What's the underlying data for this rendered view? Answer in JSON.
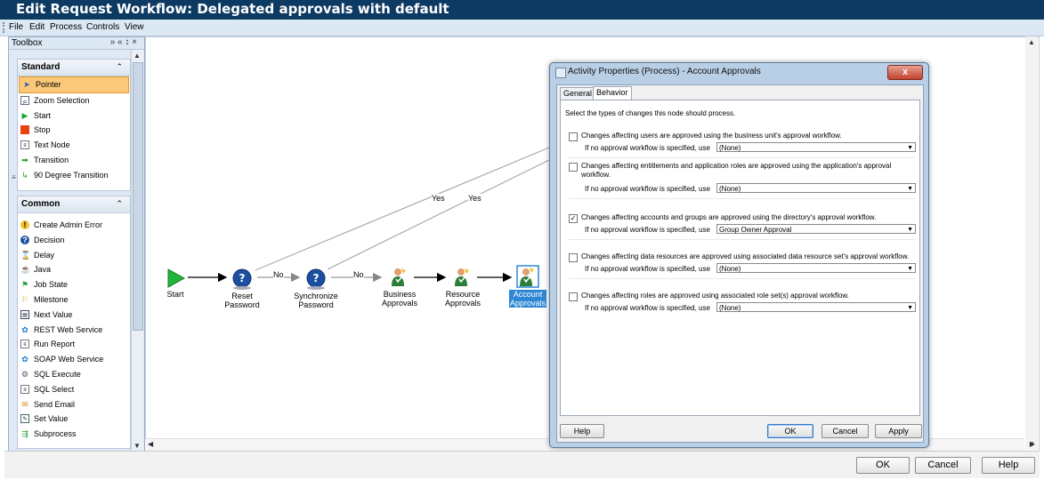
{
  "window": {
    "title": "Edit Request Workflow: Delegated approvals with default"
  },
  "menu": [
    "File",
    "Edit",
    "Process",
    "Controls",
    "View"
  ],
  "toolbox": {
    "title": "Toolbox",
    "header_controls": "» « ↕ ×",
    "sections": [
      {
        "title": "Standard",
        "items": [
          {
            "label": "Pointer",
            "icon": "pointer-icon",
            "selected": true
          },
          {
            "label": "Zoom Selection",
            "icon": "zoom-selection-icon"
          },
          {
            "label": "Start",
            "icon": "start-icon"
          },
          {
            "label": "Stop",
            "icon": "stop-icon"
          },
          {
            "label": "Text Node",
            "icon": "text-node-icon"
          },
          {
            "label": "Transition",
            "icon": "transition-icon"
          },
          {
            "label": "90 Degree Transition",
            "icon": "degree-transition-icon"
          }
        ]
      },
      {
        "title": "Common",
        "items": [
          {
            "label": "Create Admin Error",
            "icon": "admin-error-icon"
          },
          {
            "label": "Decision",
            "icon": "decision-icon"
          },
          {
            "label": "Delay",
            "icon": "delay-icon"
          },
          {
            "label": "Java",
            "icon": "java-icon"
          },
          {
            "label": "Job State",
            "icon": "job-state-icon"
          },
          {
            "label": "Milestone",
            "icon": "milestone-icon"
          },
          {
            "label": "Next Value",
            "icon": "next-value-icon"
          },
          {
            "label": "REST Web Service",
            "icon": "rest-service-icon"
          },
          {
            "label": "Run Report",
            "icon": "run-report-icon"
          },
          {
            "label": "SOAP Web Service",
            "icon": "soap-service-icon"
          },
          {
            "label": "SQL Execute",
            "icon": "sql-execute-icon"
          },
          {
            "label": "SQL Select",
            "icon": "sql-select-icon"
          },
          {
            "label": "Send Email",
            "icon": "send-email-icon"
          },
          {
            "label": "Set Value",
            "icon": "set-value-icon"
          },
          {
            "label": "Subprocess",
            "icon": "subprocess-icon"
          }
        ]
      }
    ]
  },
  "workflow": {
    "nodes": {
      "start": "Start",
      "reset": "Reset\nPassword",
      "sync": "Synchronize\nPassword",
      "business": "Business\nApprovals",
      "resource": "Resource\nApprovals",
      "account": "Account\nApprovals"
    },
    "edge_labels": {
      "no1": "No",
      "no2": "No",
      "yes1": "Yes",
      "yes2": "Yes"
    }
  },
  "dialog": {
    "title": "Activity Properties (Process) - Account Approvals",
    "close": "x",
    "tabs": [
      "General",
      "Behavior"
    ],
    "active_tab": "Behavior",
    "intro": "Select the types of changes this node should process.",
    "sub_label": "If no approval workflow is specified, use",
    "options": [
      {
        "text": "Changes affecting users are approved using the business unit's approval workflow.",
        "checked": false,
        "value": "(None)"
      },
      {
        "text": "Changes affecting entitlements and application roles are approved using the application's approval workflow.",
        "checked": false,
        "value": "(None)"
      },
      {
        "text": "Changes affecting accounts and groups are approved using the directory's approval workflow.",
        "checked": true,
        "value": "Group Owner Approval"
      },
      {
        "text": "Changes affecting data resources are approved using associated data resource set's approval workflow.",
        "checked": false,
        "value": "(None)"
      },
      {
        "text": "Changes affecting roles are approved using associated role set(s) approval workflow.",
        "checked": false,
        "value": "(None)"
      }
    ],
    "buttons": {
      "help": "Help",
      "ok": "OK",
      "cancel": "Cancel",
      "apply": "Apply"
    }
  },
  "footer": {
    "ok": "OK",
    "cancel": "Cancel",
    "help": "Help"
  }
}
